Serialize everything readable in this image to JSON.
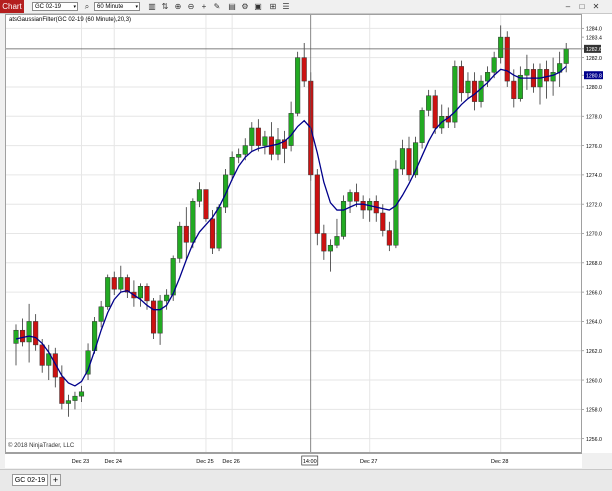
{
  "toolbar": {
    "tab_label": "Chart",
    "instrument": "GC 02-19",
    "interval": "60 Minute"
  },
  "indicator_label": "atsGaussianFilter(GC 02-19 (60 Minute),20,3)",
  "copyright": "© 2018 NinjaTrader, LLC",
  "bottom_tabs": {
    "active": "GC 02-19",
    "add_label": "+"
  },
  "crosshair": {
    "x_label": "14:00",
    "y_label": "1282.6"
  },
  "price_markers": {
    "last": "1280.8"
  },
  "colors": {
    "up": "#22aa22",
    "down": "#cc1111",
    "filter_line": "#00008b",
    "brand": "#b41e1e"
  },
  "chart_data": {
    "type": "candlestick",
    "y_ticks": [
      "1284.0",
      "1283.4",
      "1282.6",
      "1282.0",
      "1280.8",
      "1280.0",
      "1278.0",
      "1276.0",
      "1274.0",
      "1272.0",
      "1270.0",
      "1268.0",
      "1266.0",
      "1264.0",
      "1262.0",
      "1260.0",
      "1258.0",
      "1256.0"
    ],
    "ylim": [
      1255.5,
      1284.5
    ],
    "x_tick_labels": [
      {
        "label": "Dec 23",
        "bar": 10
      },
      {
        "label": "Dec 24",
        "bar": 15
      },
      {
        "label": "Dec 25",
        "bar": 29
      },
      {
        "label": "Dec 26",
        "bar": 33
      },
      {
        "label": "14:00",
        "bar": 45
      },
      {
        "label": "Dec 27",
        "bar": 54
      },
      {
        "label": "Dec 28",
        "bar": 74
      }
    ],
    "candles": [
      [
        1262.5,
        1263.8,
        1261.0,
        1263.4
      ],
      [
        1263.4,
        1264.2,
        1262.3,
        1262.6
      ],
      [
        1262.6,
        1265.2,
        1261.2,
        1264.0
      ],
      [
        1264.0,
        1264.5,
        1262.0,
        1262.4
      ],
      [
        1262.4,
        1262.8,
        1260.5,
        1261.0
      ],
      [
        1261.0,
        1262.4,
        1260.0,
        1261.8
      ],
      [
        1261.8,
        1262.2,
        1259.5,
        1260.2
      ],
      [
        1260.2,
        1261.0,
        1258.0,
        1258.4
      ],
      [
        1258.4,
        1259.0,
        1257.5,
        1258.6
      ],
      [
        1258.6,
        1259.2,
        1258.0,
        1258.9
      ],
      [
        1258.9,
        1259.6,
        1258.5,
        1259.2
      ],
      [
        1260.4,
        1262.5,
        1260.0,
        1262.0
      ],
      [
        1262.0,
        1264.3,
        1261.8,
        1264.0
      ],
      [
        1264.0,
        1265.4,
        1263.6,
        1265.0
      ],
      [
        1265.0,
        1267.2,
        1264.8,
        1267.0
      ],
      [
        1267.0,
        1267.4,
        1265.8,
        1266.2
      ],
      [
        1266.2,
        1267.8,
        1266.0,
        1267.0
      ],
      [
        1267.0,
        1267.2,
        1265.6,
        1266.0
      ],
      [
        1266.0,
        1266.8,
        1265.0,
        1265.6
      ],
      [
        1265.6,
        1266.6,
        1265.0,
        1266.4
      ],
      [
        1266.4,
        1266.6,
        1264.8,
        1265.4
      ],
      [
        1265.4,
        1265.6,
        1262.8,
        1263.2
      ],
      [
        1263.2,
        1265.8,
        1262.4,
        1265.4
      ],
      [
        1265.4,
        1266.2,
        1264.8,
        1265.8
      ],
      [
        1265.8,
        1268.5,
        1265.4,
        1268.3
      ],
      [
        1268.3,
        1270.8,
        1268.0,
        1270.5
      ],
      [
        1270.5,
        1271.8,
        1268.2,
        1269.4
      ],
      [
        1269.4,
        1272.4,
        1269.0,
        1272.2
      ],
      [
        1272.2,
        1273.5,
        1271.8,
        1273.0
      ],
      [
        1273.0,
        1271.2,
        1270.8,
        1271.0
      ],
      [
        1271.0,
        1271.6,
        1268.6,
        1269.0
      ],
      [
        1269.0,
        1272.0,
        1268.8,
        1271.8
      ],
      [
        1271.8,
        1274.4,
        1271.4,
        1274.0
      ],
      [
        1274.0,
        1275.6,
        1273.6,
        1275.2
      ],
      [
        1275.2,
        1275.8,
        1274.8,
        1275.4
      ],
      [
        1275.4,
        1276.5,
        1275.0,
        1276.0
      ],
      [
        1276.0,
        1277.6,
        1275.6,
        1277.2
      ],
      [
        1277.2,
        1277.8,
        1275.6,
        1276.0
      ],
      [
        1276.0,
        1277.0,
        1275.4,
        1276.6
      ],
      [
        1276.6,
        1277.6,
        1275.0,
        1275.4
      ],
      [
        1275.4,
        1277.2,
        1275.0,
        1276.4
      ],
      [
        1276.4,
        1277.0,
        1274.8,
        1275.8
      ],
      [
        1276.0,
        1279.0,
        1275.6,
        1278.2
      ],
      [
        1278.2,
        1282.4,
        1278.0,
        1282.0
      ],
      [
        1282.0,
        1283.0,
        1280.0,
        1280.4
      ],
      [
        1280.4,
        1281.0,
        1273.6,
        1274.0
      ],
      [
        1274.0,
        1274.4,
        1269.2,
        1270.0
      ],
      [
        1270.0,
        1270.6,
        1268.2,
        1268.8
      ],
      [
        1268.8,
        1269.6,
        1267.4,
        1269.2
      ],
      [
        1269.2,
        1271.0,
        1269.0,
        1269.8
      ],
      [
        1269.8,
        1272.6,
        1269.6,
        1272.2
      ],
      [
        1272.2,
        1273.0,
        1271.4,
        1272.8
      ],
      [
        1272.8,
        1273.4,
        1271.8,
        1272.2
      ],
      [
        1272.2,
        1272.6,
        1271.0,
        1271.6
      ],
      [
        1271.6,
        1272.4,
        1270.8,
        1272.2
      ],
      [
        1272.2,
        1272.6,
        1270.8,
        1271.4
      ],
      [
        1271.4,
        1272.0,
        1269.8,
        1270.2
      ],
      [
        1270.2,
        1270.8,
        1268.8,
        1269.2
      ],
      [
        1269.2,
        1275.0,
        1269.0,
        1274.4
      ],
      [
        1274.4,
        1276.4,
        1274.0,
        1275.8
      ],
      [
        1275.8,
        1276.6,
        1273.6,
        1274.0
      ],
      [
        1274.0,
        1276.6,
        1273.8,
        1276.2
      ],
      [
        1276.2,
        1278.6,
        1275.8,
        1278.4
      ],
      [
        1278.4,
        1279.8,
        1278.0,
        1279.4
      ],
      [
        1279.4,
        1279.8,
        1276.8,
        1277.2
      ],
      [
        1277.2,
        1278.8,
        1276.8,
        1278.0
      ],
      [
        1278.0,
        1278.6,
        1277.2,
        1277.6
      ],
      [
        1277.6,
        1281.8,
        1277.2,
        1281.4
      ],
      [
        1281.4,
        1281.8,
        1279.0,
        1279.6
      ],
      [
        1279.6,
        1281.0,
        1279.2,
        1280.4
      ],
      [
        1280.4,
        1281.0,
        1278.4,
        1279.0
      ],
      [
        1279.0,
        1280.8,
        1278.6,
        1280.4
      ],
      [
        1280.4,
        1281.4,
        1280.0,
        1281.0
      ],
      [
        1281.0,
        1282.4,
        1280.6,
        1282.0
      ],
      [
        1282.0,
        1284.2,
        1281.6,
        1283.4
      ],
      [
        1283.4,
        1283.8,
        1280.0,
        1280.4
      ],
      [
        1280.4,
        1281.2,
        1278.6,
        1279.2
      ],
      [
        1279.2,
        1281.4,
        1279.0,
        1280.8
      ],
      [
        1280.8,
        1282.2,
        1279.8,
        1281.2
      ],
      [
        1281.2,
        1281.6,
        1279.6,
        1280.0
      ],
      [
        1280.0,
        1281.6,
        1278.8,
        1281.2
      ],
      [
        1281.2,
        1281.8,
        1279.2,
        1280.4
      ],
      [
        1280.4,
        1282.0,
        1279.4,
        1281.0
      ],
      [
        1281.0,
        1282.4,
        1280.0,
        1281.6
      ],
      [
        1281.6,
        1283.0,
        1281.0,
        1282.6
      ]
    ],
    "filter_line": [
      1262.8,
      1262.9,
      1263.0,
      1262.9,
      1262.5,
      1261.9,
      1261.1,
      1260.3,
      1259.8,
      1259.6,
      1259.9,
      1260.7,
      1262.0,
      1263.4,
      1264.6,
      1265.5,
      1266.0,
      1266.1,
      1265.8,
      1265.5,
      1265.1,
      1264.8,
      1264.8,
      1265.1,
      1265.9,
      1267.0,
      1268.2,
      1269.3,
      1270.1,
      1270.6,
      1271.1,
      1271.8,
      1272.7,
      1273.7,
      1274.6,
      1275.2,
      1275.6,
      1275.8,
      1275.9,
      1276.0,
      1276.1,
      1276.3,
      1276.7,
      1277.3,
      1277.7,
      1277.2,
      1275.5,
      1273.5,
      1272.1,
      1271.6,
      1271.6,
      1271.8,
      1272.0,
      1272.0,
      1271.9,
      1271.8,
      1271.7,
      1271.6,
      1271.9,
      1272.6,
      1273.4,
      1274.3,
      1275.3,
      1276.3,
      1277.1,
      1277.6,
      1277.9,
      1278.3,
      1278.8,
      1279.2,
      1279.5,
      1279.9,
      1280.3,
      1280.8,
      1281.2,
      1281.1,
      1280.8,
      1280.6,
      1280.6,
      1280.6,
      1280.6,
      1280.7,
      1280.8,
      1281.0,
      1281.4
    ]
  }
}
